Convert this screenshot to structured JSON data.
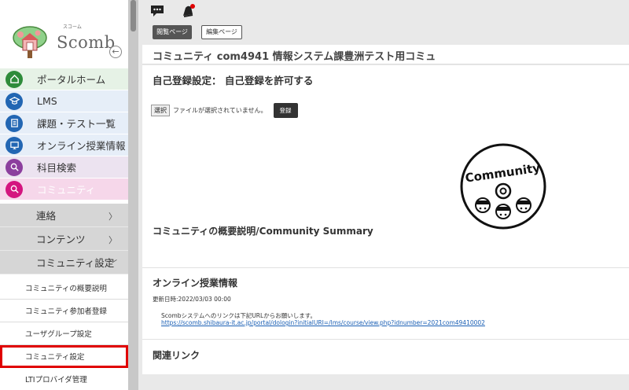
{
  "colors": {
    "portal_bg": "#e6f2e6",
    "portal_icon": "#2e8b3a",
    "lms_bg": "#e6eef8",
    "lms_icon": "#2266b3",
    "task_bg": "#e6eef8",
    "task_icon": "#2266b3",
    "online_bg": "#e6eef8",
    "online_icon": "#2266b3",
    "search_bg": "#ece3f0",
    "search_icon": "#8c3f9e",
    "community_bg": "#f6d7ea",
    "community_icon": "#d4157f",
    "active_outline": "#e00000"
  },
  "logo": {
    "text": "Scomb",
    "subtext": "スコーム"
  },
  "sidebar": {
    "collapse_icon": "circle-left-arrow-icon",
    "items": [
      {
        "label": "ポータルホーム",
        "icon": "home-icon"
      },
      {
        "label": "LMS",
        "icon": "graduation-cap-icon"
      },
      {
        "label": "課題・テスト一覧",
        "icon": "document-list-icon"
      },
      {
        "label": "オンライン授業情報",
        "icon": "monitor-icon"
      },
      {
        "label": "科目検索",
        "icon": "magnifier-icon"
      },
      {
        "label": "コミュニティ",
        "icon": "magnifier-icon"
      }
    ],
    "sub_items": [
      {
        "label": "連絡",
        "chevron": "〉"
      },
      {
        "label": "コンテンツ",
        "chevron": "〉"
      },
      {
        "label": "コミュニティ設定",
        "chevron": "﹀"
      }
    ],
    "settings_items": [
      {
        "label": "コミュニティの概要説明"
      },
      {
        "label": "コミュニティ参加者登録"
      },
      {
        "label": "ユーザグループ設定"
      },
      {
        "label": "コミュニティ設定"
      },
      {
        "label": "LTIプロバイダ管理"
      }
    ]
  },
  "topbar": {
    "chat_icon": "chat-bubble-icon",
    "bell_icon": "bell-icon"
  },
  "tabs": {
    "view": "閲覧ページ",
    "edit": "編集ページ"
  },
  "page": {
    "title": "コミュニティ com4941 情報システム課豊洲テスト用コミュ",
    "self_registration": "自己登録設定： 自己登録を許可する",
    "file_button": "選択",
    "file_status": "ファイルが選択されていません。",
    "register_button": "登録",
    "community_image_text": "Community",
    "summary_heading": "コミュニティの概要説明/Community Summary",
    "online_heading": "オンライン授業情報",
    "updated": "更新日時:2022/03/03 00:00",
    "online_note": "Scombシステムへのリンクは下記URLからお願いします。",
    "online_link": "https://scomb.shibaura-it.ac.jp/portal/dologin?initialURI=/lms/course/view.php?idnumber=2021com49410002",
    "related_heading": "関連リンク"
  }
}
